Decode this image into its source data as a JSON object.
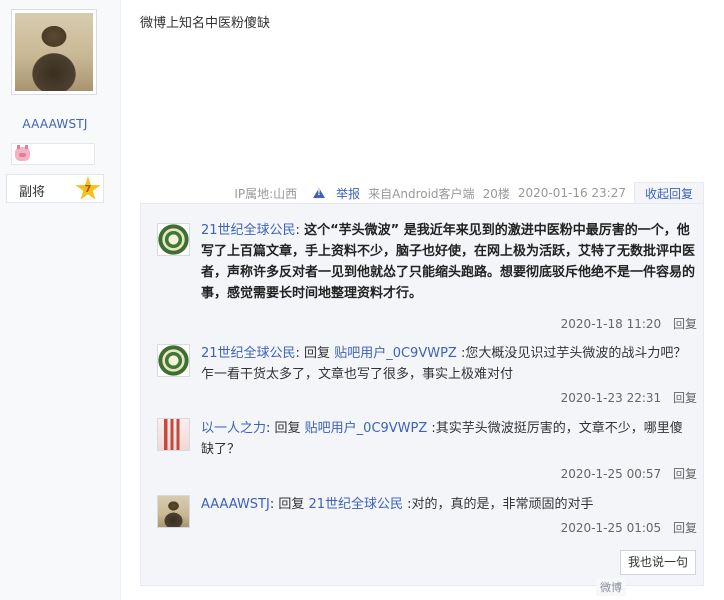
{
  "user": {
    "name": "AAAAWSTJ",
    "level_title": "副将",
    "level_number": "7"
  },
  "post": {
    "content": "微博上知名中医粉傻缺",
    "ip_location": "IP属地:山西",
    "report_label": "举报",
    "source": "来自Android客户端",
    "floor": "20楼",
    "time": "2020-01-16 23:27",
    "collapse_label": "收起回复"
  },
  "replies": [
    {
      "author": "21世纪全球公民",
      "colon": ":",
      "text": "这个“芋头微波” 是我近年来见到的激进中医粉中最厉害的一个，他写了上百篇文章，手上资料不少，脑子也好使，在网上极为活跃，艾特了无数批评中医者，声称许多反对者一见到他就怂了只能缩头跑路。想要彻底驳斥他绝不是一件容易的事，感觉需要长时间地整理资料才行。",
      "time": "2020-1-18 11:20",
      "reply_label": "回复"
    },
    {
      "author": "21世纪全球公民",
      "prefix": ": 回复 ",
      "target": "贴吧用户_0C9VWPZ",
      "text": " :您大概没见识过芋头微波的战斗力吧？乍一看干货太多了，文章也写了很多，事实上极难对付",
      "time": "2020-1-23 22:31",
      "reply_label": "回复"
    },
    {
      "author": "以一人之力",
      "prefix": ": 回复 ",
      "target": "贴吧用户_0C9VWPZ",
      "text": " :其实芋头微波挺厉害的，文章不少，哪里傻缺了？",
      "time": "2020-1-25 00:57",
      "reply_label": "回复"
    },
    {
      "author": "AAAAWSTJ",
      "prefix": ": 回复 ",
      "target": "21世纪全球公民",
      "text": " :对的，真的是，非常顽固的对手",
      "time": "2020-1-25 01:05",
      "reply_label": "回复"
    }
  ],
  "say_button": "我也说一句",
  "watermark": "微博"
}
